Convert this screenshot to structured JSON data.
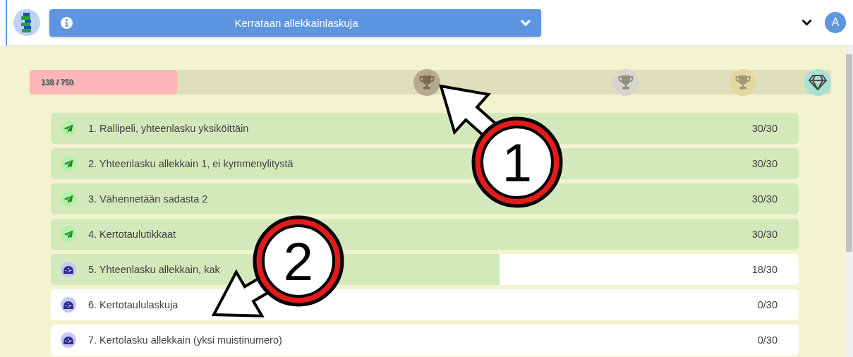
{
  "header": {
    "title": "Kerrataan allekkainlaskuja",
    "avatar": "A"
  },
  "progress": {
    "reading": "138 / 750",
    "level": 0.184,
    "milestones": [
      {
        "kind": "bronze"
      },
      {
        "kind": "silver"
      },
      {
        "kind": "gold"
      },
      {
        "kind": "diamond"
      }
    ]
  },
  "exercises": [
    {
      "kind": "plane",
      "title": "1. Rallipeli, yhteenlasku yksiköittäin",
      "score": "30/30",
      "level": 1
    },
    {
      "kind": "plane",
      "title": "2. Yhteenlasku allekkain 1, ei kymmenylitystä",
      "score": "30/30",
      "level": 1
    },
    {
      "kind": "plane",
      "title": "3. Vähennetään sadasta 2",
      "score": "30/30",
      "level": 1
    },
    {
      "kind": "plane",
      "title": "4. Kertotaulutikkaat",
      "score": "30/30",
      "level": 1
    },
    {
      "kind": "gauge",
      "title": "5. Yhteenlasku allekkain, kak",
      "score": "18/30",
      "level": 0.6
    },
    {
      "kind": "gauge",
      "title": "6. Kertotaululaskuja",
      "score": "0/30",
      "level": 0
    },
    {
      "kind": "gauge",
      "title": "7. Kertolasku allekkain (yksi muistinumero)",
      "score": "0/30",
      "level": 0
    }
  ],
  "callouts": [
    {
      "number": "1"
    },
    {
      "number": "2"
    }
  ]
}
